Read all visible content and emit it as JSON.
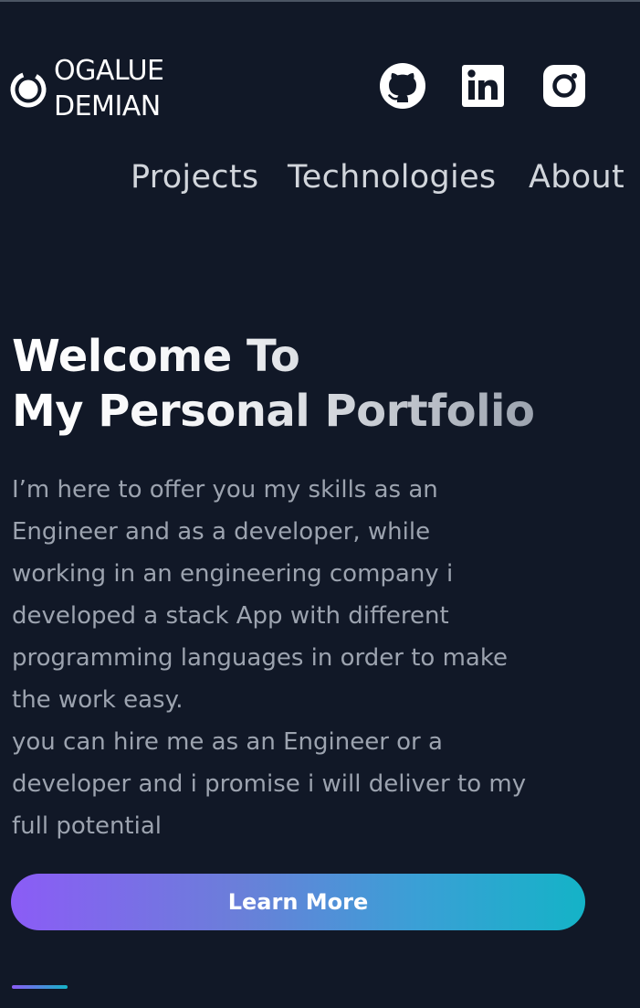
{
  "header": {
    "brand": {
      "line1": "OGALUE",
      "line2": "DEMIAN",
      "icon": "brand-circle-icon"
    },
    "social": [
      {
        "name": "github",
        "icon": "github-icon"
      },
      {
        "name": "linkedin",
        "icon": "linkedin-icon"
      },
      {
        "name": "instagram",
        "icon": "instagram-icon"
      }
    ]
  },
  "nav": {
    "items": [
      {
        "label": "Projects"
      },
      {
        "label": "Technologies"
      },
      {
        "label": "About"
      }
    ]
  },
  "hero": {
    "title_line1": "Welcome To",
    "title_line2": "My Personal Portfolio",
    "paragraph_lines": [
      "I’m here to offer you my skills as an",
      "Engineer and as a developer, while",
      "working in an engineering company i",
      "developed a stack App with different",
      "programming languages in order to make",
      "the work easy.",
      "you can hire me as an Engineer or a",
      "developer and i promise i will deliver to my",
      "full potential"
    ],
    "cta_label": "Learn More"
  },
  "colors": {
    "background": "#111827",
    "text_primary": "#ffffff",
    "text_secondary": "#9ca3af",
    "nav_text": "#d1d5db",
    "gradient_start": "#8b5cf6",
    "gradient_end": "#14b3c7"
  }
}
